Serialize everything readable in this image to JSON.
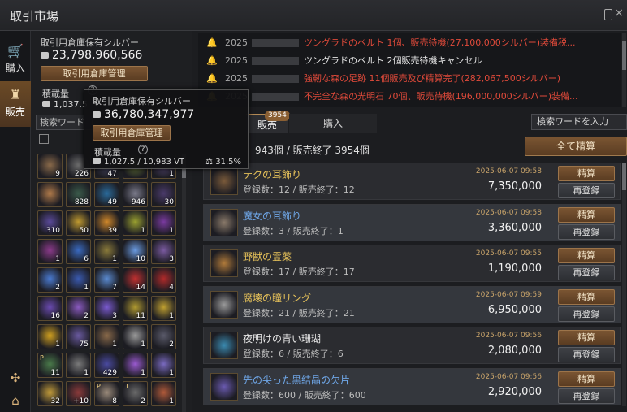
{
  "window": {
    "title": "取引市場"
  },
  "nav": {
    "buy": {
      "label": "購入",
      "icon": "cart-icon"
    },
    "sell": {
      "label": "販売",
      "icon": "sack-icon"
    }
  },
  "warehouse": {
    "label": "取引用倉庫保有シルバー",
    "silver": "23,798,960,566",
    "manage_button": "取引用倉庫管理",
    "weight_label": "積載量",
    "weight_value": "1,037.5",
    "search_placeholder": "検索ワード"
  },
  "tooltip": {
    "label": "取引用倉庫保有シルバー",
    "silver": "36,780,347,977",
    "manage_button": "取引用倉庫管理",
    "weight_label": "積載量",
    "weight_value": "1,027.5 / 10,983 VT",
    "weight_percent": "31.5%"
  },
  "grid_items": [
    {
      "num": "9",
      "color": "#8a6a4a"
    },
    {
      "num": "226",
      "color": "#6d6d6d"
    },
    {
      "num": "47",
      "color": "#4a4a6a"
    },
    {
      "num": "",
      "color": "#6a7a3a"
    },
    {
      "num": "1",
      "color": "#5a4a7a"
    },
    {
      "num": "",
      "color": "#b07a4a"
    },
    {
      "num": "828",
      "color": "#3a5a4a"
    },
    {
      "num": "49",
      "color": "#2a6a9a"
    },
    {
      "num": "946",
      "color": "#7a7a8a"
    },
    {
      "num": "30",
      "color": "#4a3a6a"
    },
    {
      "num": "310",
      "color": "#5a4a9a"
    },
    {
      "num": "50",
      "color": "#c09a30"
    },
    {
      "num": "39",
      "color": "#d0882a"
    },
    {
      "num": "1",
      "color": "#9aa030"
    },
    {
      "num": "1",
      "color": "#7a3aa0"
    },
    {
      "num": "1",
      "color": "#8a3a8a"
    },
    {
      "num": "6",
      "color": "#3a6ac0"
    },
    {
      "num": "1",
      "color": "#8a7a3a"
    },
    {
      "num": "10",
      "color": "#6a9ae0"
    },
    {
      "num": "3",
      "color": "#7a5aa0"
    },
    {
      "num": "2",
      "color": "#4a7ad0"
    },
    {
      "num": "1",
      "color": "#3a5ab0"
    },
    {
      "num": "7",
      "color": "#5a8ad0"
    },
    {
      "num": "14",
      "color": "#c03030"
    },
    {
      "num": "4",
      "color": "#b02a2a"
    },
    {
      "num": "16",
      "color": "#6a4ab0"
    },
    {
      "num": "2",
      "color": "#8a5ac0"
    },
    {
      "num": "3",
      "color": "#7a5ad0"
    },
    {
      "num": "11",
      "color": "#b09a30"
    },
    {
      "num": "1",
      "color": "#c0a030"
    },
    {
      "num": "1",
      "color": "#d0a020"
    },
    {
      "num": "75",
      "color": "#6a5aa0"
    },
    {
      "num": "1",
      "color": "#8a6a4a"
    },
    {
      "num": "1",
      "color": "#9a9a9a"
    },
    {
      "num": "2",
      "color": "#5a5a6a"
    },
    {
      "num": "11",
      "color": "#4a7a4a",
      "tag": "P"
    },
    {
      "num": "1",
      "color": "#7a7a7a"
    },
    {
      "num": "429",
      "color": "#4a4aa0"
    },
    {
      "num": "1",
      "color": "#9a5ad0"
    },
    {
      "num": "1",
      "color": "#7a6ac0"
    },
    {
      "num": "32",
      "color": "#c09a3a"
    },
    {
      "num": "+10",
      "color": "#8a3a3a"
    },
    {
      "num": "8",
      "color": "#9a8a7a",
      "tag": "P"
    },
    {
      "num": "2",
      "color": "#6a6a6a",
      "tag": "T"
    },
    {
      "num": "1",
      "color": "#b05a3a"
    }
  ],
  "notices": [
    {
      "date": "2025",
      "text": "ツングラドのベルト 1個、販売待機(27,100,000シルバー)装備税...",
      "color": "#e04a3a"
    },
    {
      "date": "2025",
      "text": "ツングラドのベルト 2個販売待機キャンセル",
      "color": "#e6e6e6"
    },
    {
      "date": "2025",
      "text": "強靭な森の足跡 11個販売及び精算完了(282,067,500シルバー)",
      "color": "#e04a3a"
    },
    {
      "date": "2025",
      "text": "不完全な森の光明石 70個、販売待機(196,000,000シルバー)装備...",
      "color": "#e04a3a"
    }
  ],
  "tabs": {
    "sell": "販売",
    "sell_badge": "3954",
    "buy": "購入"
  },
  "search": {
    "placeholder": "検索ワードを入力"
  },
  "summary": {
    "text": "943個 / 販売終了 3954個"
  },
  "settle_all_button": "全て精算",
  "listings": [
    {
      "name": "テクの耳飾り",
      "name_color": "gold",
      "count": "登録数：12 / 販売終了：12",
      "time": "2025-06-07 09:58",
      "price": "7,350,000",
      "thumb": "#7a5a3a"
    },
    {
      "name": "魔女の耳飾り",
      "name_color": "blue",
      "count": "登録数：3 / 販売終了：1",
      "time": "2025-06-07 09:58",
      "price": "3,360,000",
      "thumb": "#8a7a6a"
    },
    {
      "name": "野獣の霊薬",
      "name_color": "gold",
      "count": "登録数：17 / 販売終了：17",
      "time": "2025-06-07 09:55",
      "price": "1,190,000",
      "thumb": "#b07a3a"
    },
    {
      "name": "腐壊の瞳リング",
      "name_color": "gold",
      "count": "登録数：21 / 販売終了：21",
      "time": "2025-06-07 09:59",
      "price": "6,950,000",
      "thumb": "#9a9a9a"
    },
    {
      "name": "夜明けの青い珊瑚",
      "name_color": "white",
      "count": "登録数：6 / 販売終了：6",
      "time": "2025-06-07 09:56",
      "price": "2,080,000",
      "thumb": "#3a8ab0"
    },
    {
      "name": "先の尖った黒結晶の欠片",
      "name_color": "blue",
      "count": "登録数：600 / 販売終了：600",
      "time": "2025-06-07 09:56",
      "price": "2,920,000",
      "thumb": "#6a5ab0"
    }
  ],
  "row_buttons": {
    "settle": "精算",
    "relist": "再登録"
  }
}
